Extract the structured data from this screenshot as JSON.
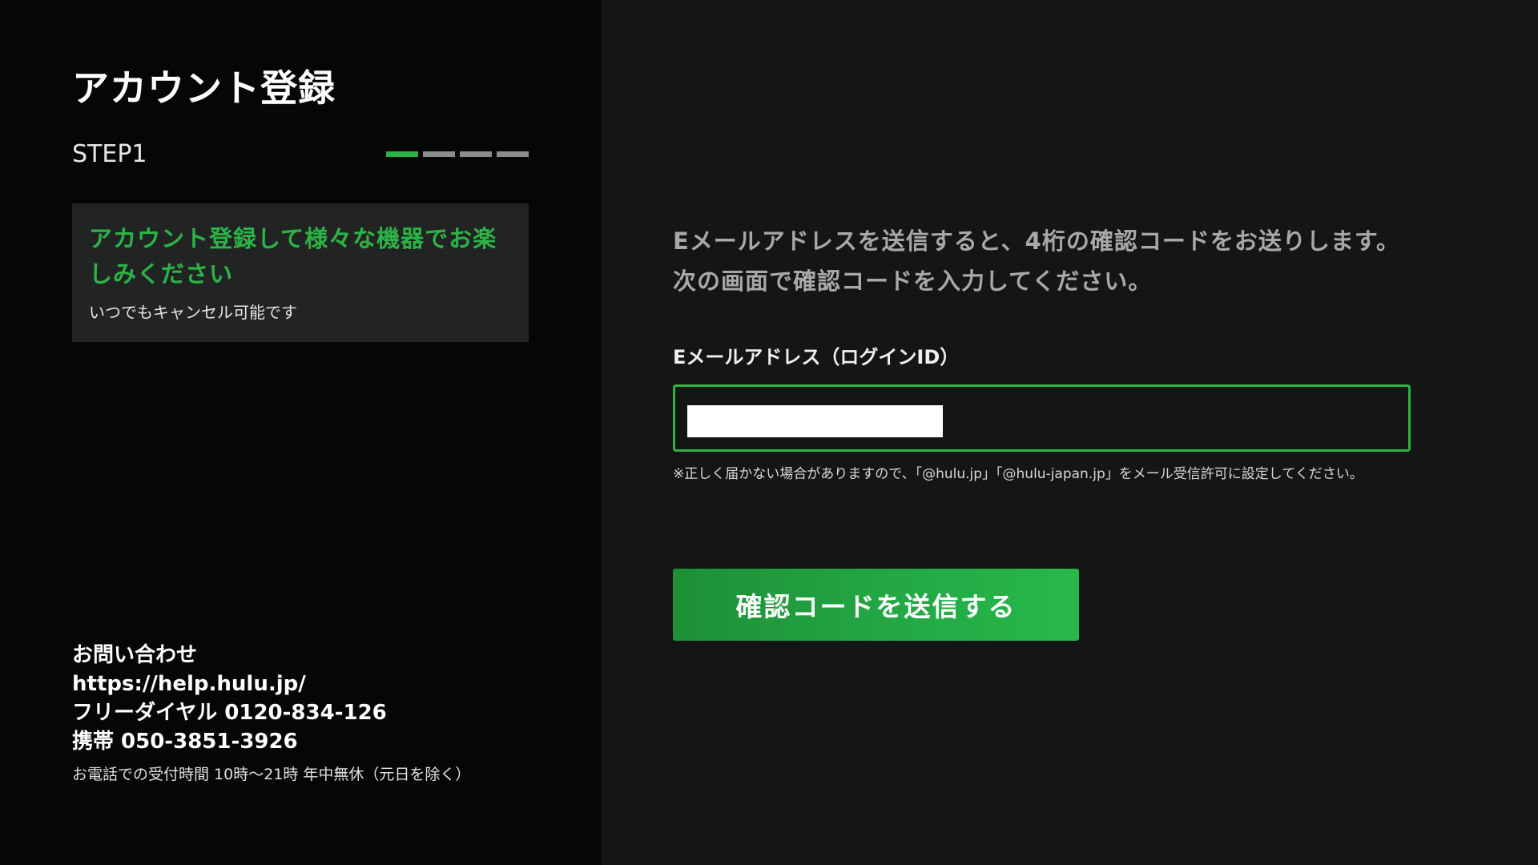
{
  "header": {
    "title": "アカウント登録",
    "step_label": "STEP1",
    "steps": {
      "total": 4,
      "current": 1,
      "active_color": "#2cb346",
      "inactive_color": "#8c8c8c"
    }
  },
  "promo": {
    "title": "アカウント登録して様々な機器でお楽しみください",
    "title_color": "#2cb346",
    "subtitle": "いつでもキャンセル可能です"
  },
  "contact": {
    "heading": "お問い合わせ",
    "url": "https://help.hulu.jp/",
    "freedial": "フリーダイヤル 0120-834-126",
    "mobile": "携帯 050-3851-3926",
    "hours": "お電話での受付時間 10時〜21時 年中無休（元日を除く）"
  },
  "form": {
    "instruction_line1": "Eメールアドレスを送信すると、4桁の確認コードをお送りします。",
    "instruction_line2": "次の画面で確認コードを入力してください。",
    "email_label": "Eメールアドレス（ログインID）",
    "email_value": "",
    "email_note": "※正しく届かない場合がありますので、「@hulu.jp」「@hulu-japan.jp」をメール受信許可に設定してください。",
    "submit_label": "確認コードを送信する",
    "accent_color": "#2cb346"
  }
}
